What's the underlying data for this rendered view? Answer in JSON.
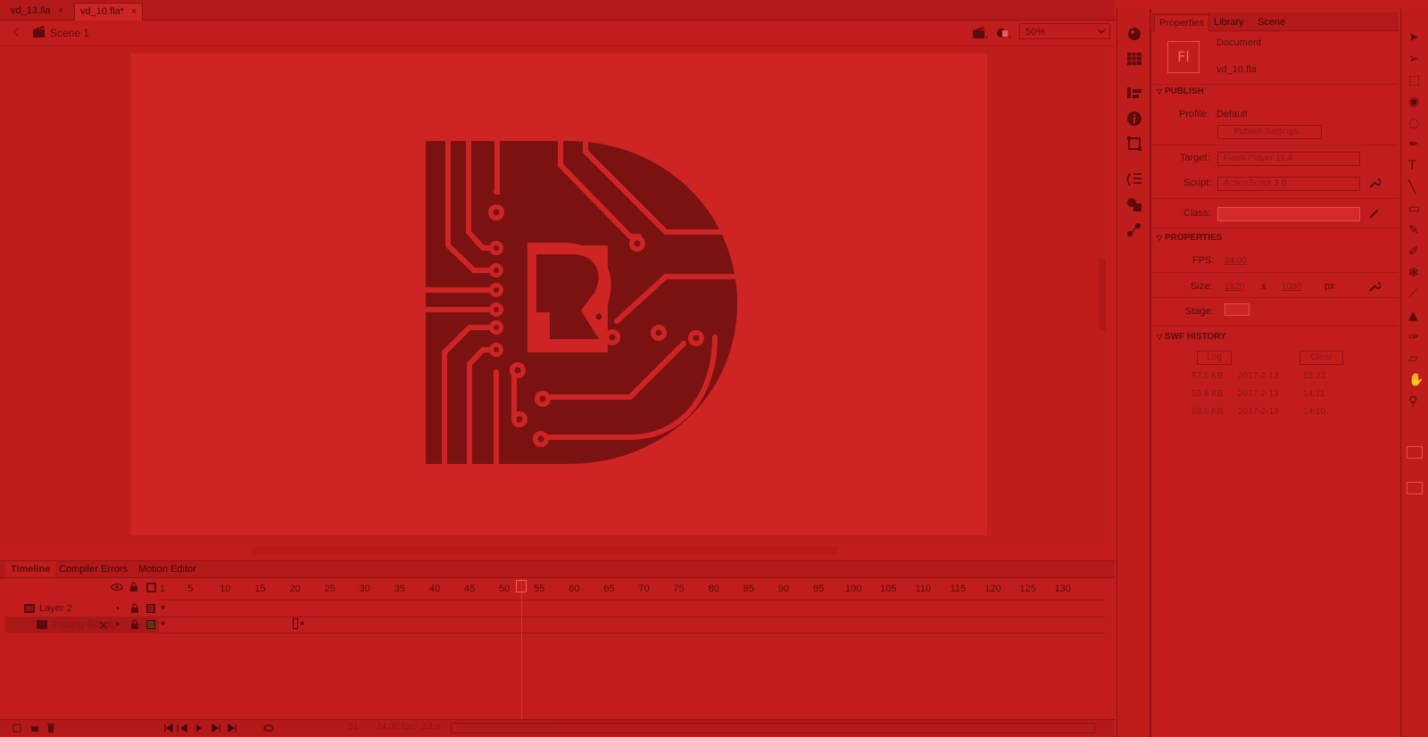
{
  "document_tabs": [
    {
      "label": "vd_13.fla",
      "close": "×"
    },
    {
      "label": "vd_10.fla*",
      "close": "×"
    }
  ],
  "edit_bar": {
    "scene_label": "Scene 1",
    "zoom": "50%"
  },
  "timeline": {
    "tabs": [
      "Timeline",
      "Compiler Errors",
      "Motion Editor"
    ],
    "ruler_labels": [
      "1",
      "5",
      "10",
      "15",
      "20",
      "25",
      "30",
      "35",
      "40",
      "45",
      "50",
      "55",
      "60",
      "65",
      "70",
      "75",
      "80",
      "85",
      "90",
      "95",
      "100",
      "105",
      "110",
      "115",
      "120",
      "125",
      "130"
    ],
    "current_frame": 51,
    "layers": [
      {
        "name": "Layer 2"
      },
      {
        "name": "Tracing Bitmap"
      }
    ],
    "status": {
      "frame": "51",
      "fps": "24.00 fps",
      "time": "2.1 s"
    }
  },
  "properties": {
    "tabs": [
      "Properties",
      "Library",
      "Scene"
    ],
    "doc_type": "Document",
    "doc_name": "vd_10.fla",
    "icon_text": "Fl",
    "publish": {
      "title": "PUBLISH",
      "profile_label": "Profile:",
      "profile_value": "Default",
      "settings_button": "Publish Settings...",
      "target_label": "Target:",
      "target_value": "Flash Player 11.4",
      "script_label": "Script:",
      "script_value": "ActionScript 3.0",
      "class_label": "Class:",
      "class_value": ""
    },
    "props": {
      "title": "PROPERTIES",
      "fps_label": "FPS:",
      "fps_value": "24.00",
      "size_label": "Size:",
      "width": "1920",
      "x": "x",
      "height": "1080",
      "unit": "px",
      "stage_label": "Stage:",
      "stage_color": "#cf2424"
    },
    "swf_history": {
      "title": "SWF HISTORY",
      "log_button": "Log",
      "clear_button": "Clear",
      "entries": [
        {
          "size": "57.5 KB",
          "date": "2017-2-13",
          "time": "15:22"
        },
        {
          "size": "59.6 KB",
          "date": "2017-2-13",
          "time": "14:11"
        },
        {
          "size": "59.6 KB",
          "date": "2017-2-13",
          "time": "14:10"
        }
      ]
    }
  },
  "icons": {
    "dock_strip": [
      "color-icon",
      "swatches-icon",
      "align-icon",
      "info-icon",
      "transform-icon",
      "code-snippets-icon",
      "components-icon",
      "motion-presets-icon"
    ],
    "tools": [
      "selection-tool-icon",
      "subselection-tool-icon",
      "free-transform-tool-icon",
      "3d-rotation-tool-icon",
      "lasso-tool-icon",
      "pen-tool-icon",
      "text-tool-icon",
      "line-tool-icon",
      "rectangle-tool-icon",
      "pencil-tool-icon",
      "brush-tool-icon",
      "deco-tool-icon",
      "bone-tool-icon",
      "paint-bucket-tool-icon",
      "eyedropper-tool-icon",
      "eraser-tool-icon",
      "hand-tool-icon",
      "zoom-tool-icon"
    ]
  },
  "colors": {
    "background": "#c21d1d",
    "stage": "#cf2424",
    "logo": "#7a1212",
    "playhead": "#ff5a5a"
  }
}
